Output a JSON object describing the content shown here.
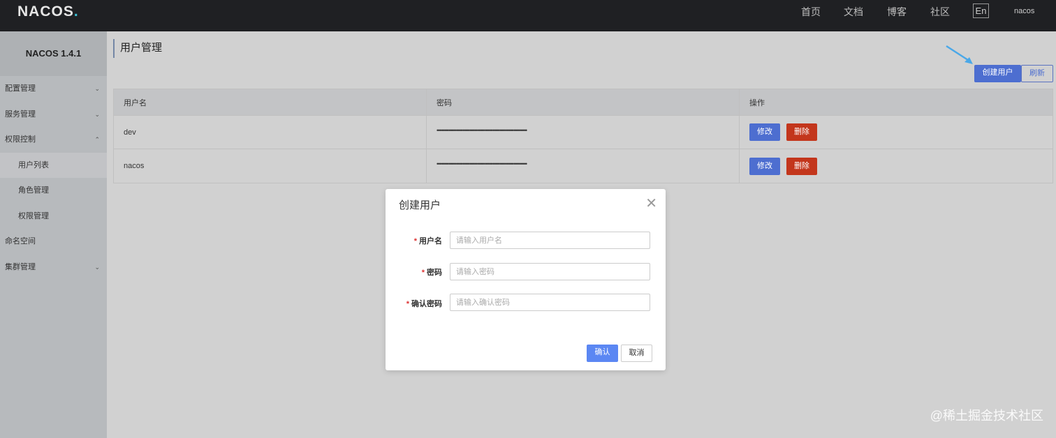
{
  "header": {
    "logo": "NACOS",
    "nav": [
      "首页",
      "文档",
      "博客",
      "社区"
    ],
    "lang": "En",
    "user": "nacos"
  },
  "sidebar": {
    "version": "NACOS 1.4.1",
    "items": [
      {
        "label": "配置管理",
        "chev": "⌄"
      },
      {
        "label": "服务管理",
        "chev": "⌄"
      },
      {
        "label": "权限控制",
        "chev": "⌃"
      },
      {
        "label": "用户列表"
      },
      {
        "label": "角色管理"
      },
      {
        "label": "权限管理"
      },
      {
        "label": "命名空间"
      },
      {
        "label": "集群管理",
        "chev": "⌄"
      }
    ]
  },
  "main": {
    "title": "用户管理",
    "create": "创建用户",
    "refresh": "刷新",
    "columns": [
      "用户名",
      "密码",
      "操作"
    ],
    "rows": [
      {
        "user": "dev",
        "pw": "••••••••••••••••••••••••••••••••••••••••••••••••••••••••••••",
        "edit": "修改",
        "del": "删除"
      },
      {
        "user": "nacos",
        "pw": "••••••••••••••••••••••••••••••••••••••••••••••••••••••••••••",
        "edit": "修改",
        "del": "删除"
      }
    ]
  },
  "modal": {
    "title": "创建用户",
    "fields": [
      {
        "label": "用户名",
        "placeholder": "请输入用户名"
      },
      {
        "label": "密码",
        "placeholder": "请输入密码"
      },
      {
        "label": "确认密码",
        "placeholder": "请输入确认密码"
      }
    ],
    "ok": "确认",
    "cancel": "取消"
  },
  "watermark": "@稀土掘金技术社区",
  "colors": {
    "primary": "#4d6ed0",
    "danger": "#c3361c",
    "arrow": "#4aa8e8"
  }
}
